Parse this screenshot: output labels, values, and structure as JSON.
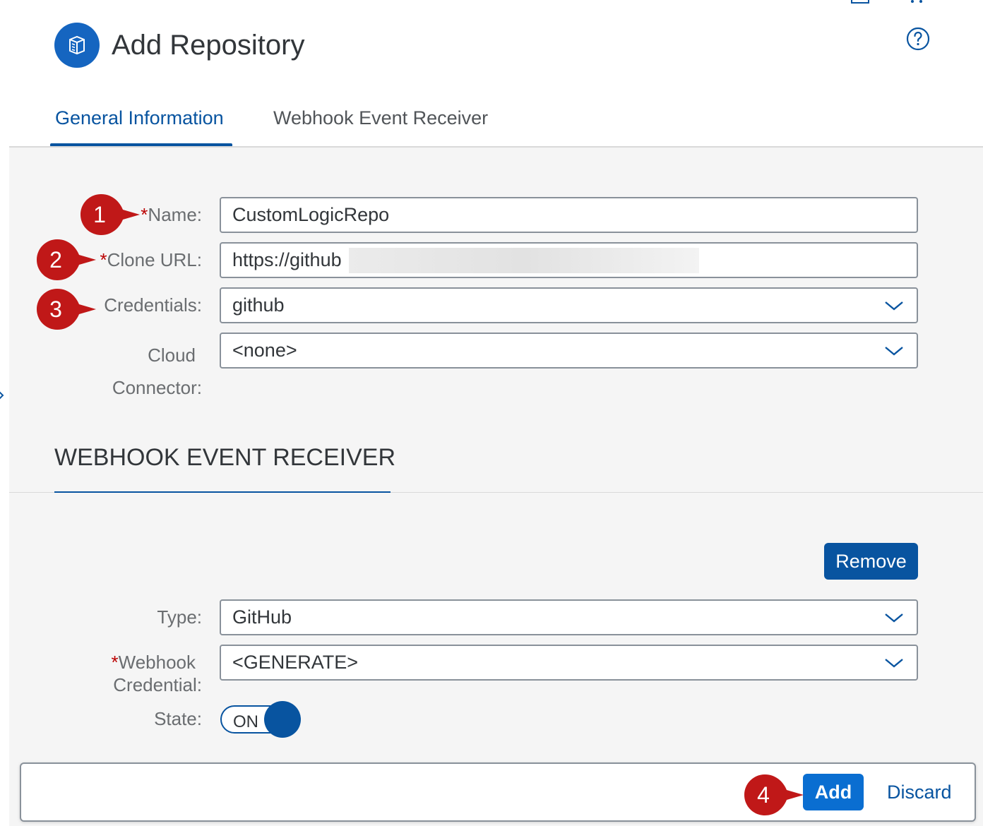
{
  "header": {
    "title": "Add Repository",
    "icon": "repository-icon",
    "help_icon": "help-icon",
    "accent_color": "#1565c0"
  },
  "tabs": [
    {
      "label": "General Information",
      "active": true
    },
    {
      "label": "Webhook Event Receiver",
      "active": false
    }
  ],
  "general": {
    "name": {
      "required_mark": "*",
      "label": "Name:",
      "value": "CustomLogicRepo"
    },
    "clone_url": {
      "required_mark": "*",
      "label": "Clone URL:",
      "value": "https://github"
    },
    "credentials": {
      "label": "Credentials:",
      "value": "github"
    },
    "cloud_connector": {
      "label_line1": "Cloud",
      "label_line2": "Connector:",
      "value": "<none>"
    }
  },
  "webhook": {
    "section_title": "WEBHOOK EVENT RECEIVER",
    "remove_label": "Remove",
    "type": {
      "label": "Type:",
      "value": "GitHub"
    },
    "credential": {
      "required_mark": "*",
      "label_line1": "Webhook",
      "label_line2": "Credential:",
      "value": "<GENERATE>"
    },
    "state": {
      "label": "State:",
      "value": "ON"
    }
  },
  "footer": {
    "add_label": "Add",
    "discard_label": "Discard"
  },
  "markers": [
    "1",
    "2",
    "3",
    "4"
  ],
  "colors": {
    "primary": "#0854a0",
    "emphasized_button": "#0a6ed1",
    "required": "#bb0000",
    "marker": "#c01818"
  }
}
